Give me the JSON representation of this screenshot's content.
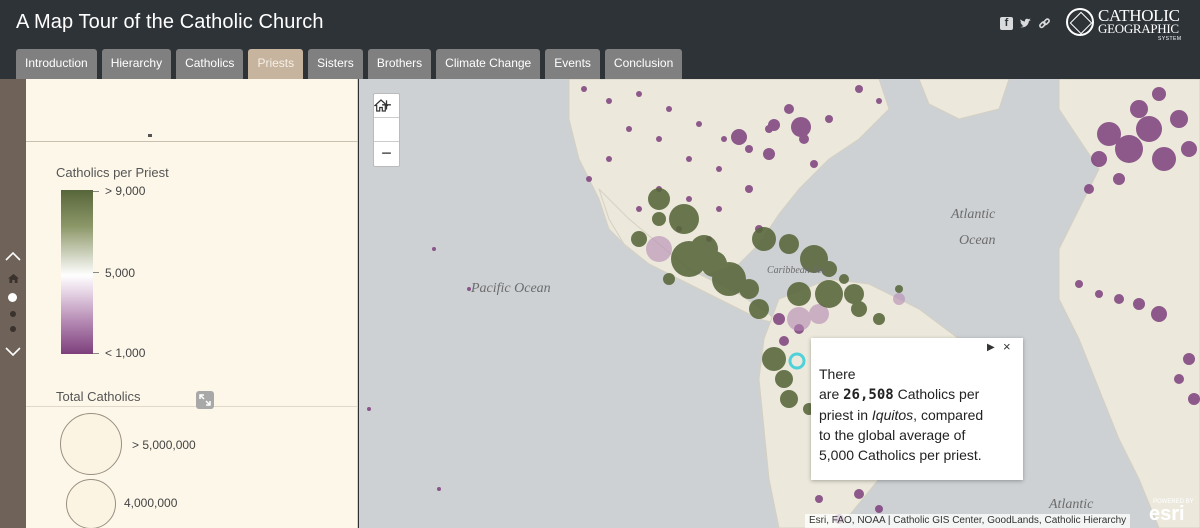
{
  "app": {
    "title": "A Map Tour of the Catholic Church"
  },
  "header": {
    "social_icons": [
      "facebook-icon",
      "twitter-icon",
      "link-icon"
    ],
    "logo": {
      "line1": "CATHOLIC",
      "line2": "GEOGRAPHIC",
      "line3": "SYSTEM"
    }
  },
  "tabs": [
    {
      "label": "Introduction",
      "active": false
    },
    {
      "label": "Hierarchy",
      "active": false
    },
    {
      "label": "Catholics",
      "active": false
    },
    {
      "label": "Priests",
      "active": true
    },
    {
      "label": "Sisters",
      "active": false
    },
    {
      "label": "Brothers",
      "active": false
    },
    {
      "label": "Climate Change",
      "active": false
    },
    {
      "label": "Events",
      "active": false
    },
    {
      "label": "Conclusion",
      "active": false
    }
  ],
  "nav": {
    "icons": [
      "chevron-up-icon",
      "home-icon",
      "chevron-down-icon"
    ],
    "dots": 3,
    "current_dot": 1
  },
  "legend": {
    "ramp_title": "Catholics per Priest",
    "ramp_labels": {
      "high": "> 9,000",
      "mid": "5,000",
      "low": "< 1,000"
    },
    "size_title": "Total Catholics",
    "size_labels": [
      "> 5,000,000",
      "4,000,000"
    ]
  },
  "map": {
    "labels": {
      "pacific": "Pacific Ocean",
      "atlantic_1": "Atlantic",
      "atlantic_2": "Ocean",
      "atlantic_3": "Atlantic",
      "caribbean": "Caribbean Sea"
    },
    "zoom": {
      "in": "+",
      "out": "−"
    },
    "attribution": "Esri, FAO, NOAA | Catholic GIS Center, GoodLands, Catholic Hierarchy",
    "powered_by": "POWERED BY",
    "esri": "esri",
    "colors": {
      "high": "#57663a",
      "low": "#7d3f7c",
      "selected": "#4fd1d9"
    }
  },
  "popup": {
    "line1": "There",
    "line2_pre": "are ",
    "value": "26,508",
    "line2_post": " Catholics per",
    "line3_pre": "priest in ",
    "place": "Iquitos",
    "line3_post": ", compared",
    "line4": "to the global average of",
    "line5": "5,000 Catholics per priest."
  }
}
